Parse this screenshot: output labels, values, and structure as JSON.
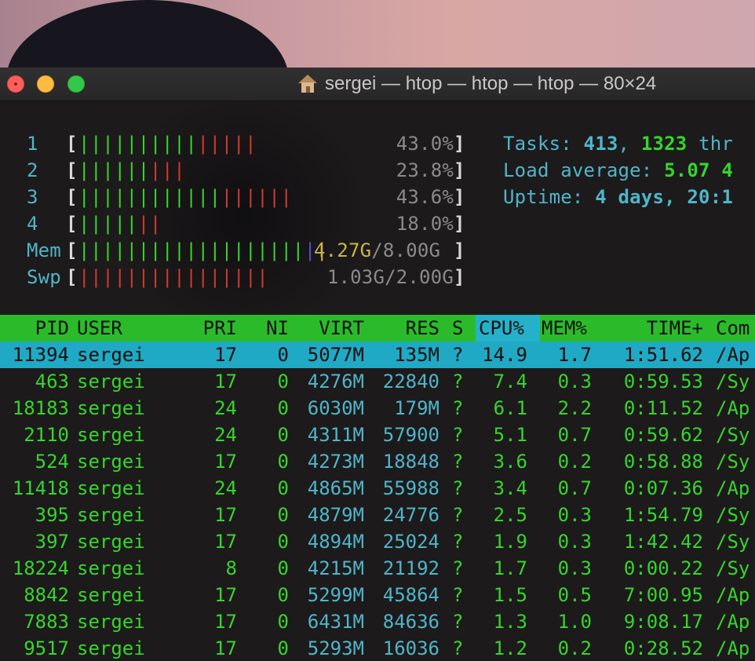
{
  "window": {
    "title": "sergei — htop — htop — htop — 80×24"
  },
  "meters": {
    "cpus": [
      {
        "label": "1",
        "green_bars": "||||||||||",
        "red_bars": "|||||",
        "value": "43.0%"
      },
      {
        "label": "2",
        "green_bars": "||||||",
        "red_bars": "|||",
        "value": "23.8%"
      },
      {
        "label": "3",
        "green_bars": "||||||||||||",
        "red_bars": "||||||",
        "value": "43.6%"
      },
      {
        "label": "4",
        "green_bars": "|||||",
        "red_bars": "||",
        "value": "18.0%"
      }
    ],
    "mem": {
      "label": "Mem",
      "green_bars": "|||||||||||||||||||",
      "blue_bars": "|",
      "yellow_bars": "|",
      "used": "4.27G",
      "total": "/8.00G"
    },
    "swp": {
      "label": "Swp",
      "red_bars": "||||||||||||||||",
      "value": "1.03G/2.00G"
    }
  },
  "summary": {
    "tasks_label": "Tasks: ",
    "tasks_value": "413",
    "tasks_sep": ", ",
    "threads_value": "1323",
    "threads_label": " thr",
    "load_label": "Load average: ",
    "load_value": "5.07 4",
    "uptime_label": "Uptime: ",
    "uptime_value": "4 days, 20:1"
  },
  "table": {
    "headers": {
      "pid": "PID",
      "user": "USER",
      "pri": "PRI",
      "ni": "NI",
      "virt": "VIRT",
      "res": "RES",
      "s": "S",
      "cpu": "CPU%",
      "mem": "MEM%",
      "time": "TIME+",
      "cmd": "Com"
    },
    "rows": [
      {
        "pid": "11394",
        "user": "sergei",
        "pri": "17",
        "ni": "0",
        "virt": "5077M",
        "res": "135M",
        "s": "?",
        "cpu": "14.9",
        "mem": "1.7",
        "time": "1:51.62",
        "cmd": "/Ap"
      },
      {
        "pid": "463",
        "user": "sergei",
        "pri": "17",
        "ni": "0",
        "virt": "4276M",
        "res": "22840",
        "s": "?",
        "cpu": "7.4",
        "mem": "0.3",
        "time": "0:59.53",
        "cmd": "/Sy"
      },
      {
        "pid": "18183",
        "user": "sergei",
        "pri": "24",
        "ni": "0",
        "virt": "6030M",
        "res": "179M",
        "s": "?",
        "cpu": "6.1",
        "mem": "2.2",
        "time": "0:11.52",
        "cmd": "/Ap"
      },
      {
        "pid": "2110",
        "user": "sergei",
        "pri": "24",
        "ni": "0",
        "virt": "4311M",
        "res": "57900",
        "s": "?",
        "cpu": "5.1",
        "mem": "0.7",
        "time": "0:59.62",
        "cmd": "/Sy"
      },
      {
        "pid": "524",
        "user": "sergei",
        "pri": "17",
        "ni": "0",
        "virt": "4273M",
        "res": "18848",
        "s": "?",
        "cpu": "3.6",
        "mem": "0.2",
        "time": "0:58.88",
        "cmd": "/Sy"
      },
      {
        "pid": "11418",
        "user": "sergei",
        "pri": "24",
        "ni": "0",
        "virt": "4865M",
        "res": "55988",
        "s": "?",
        "cpu": "3.4",
        "mem": "0.7",
        "time": "0:07.36",
        "cmd": "/Ap"
      },
      {
        "pid": "395",
        "user": "sergei",
        "pri": "17",
        "ni": "0",
        "virt": "4879M",
        "res": "24776",
        "s": "?",
        "cpu": "2.5",
        "mem": "0.3",
        "time": "1:54.79",
        "cmd": "/Sy"
      },
      {
        "pid": "397",
        "user": "sergei",
        "pri": "17",
        "ni": "0",
        "virt": "4894M",
        "res": "25024",
        "s": "?",
        "cpu": "1.9",
        "mem": "0.3",
        "time": "1:42.42",
        "cmd": "/Sy"
      },
      {
        "pid": "18224",
        "user": "sergei",
        "pri": "8",
        "ni": "0",
        "virt": "4215M",
        "res": "21192",
        "s": "?",
        "cpu": "1.7",
        "mem": "0.3",
        "time": "0:00.22",
        "cmd": "/Sy"
      },
      {
        "pid": "8842",
        "user": "sergei",
        "pri": "17",
        "ni": "0",
        "virt": "5299M",
        "res": "45864",
        "s": "?",
        "cpu": "1.5",
        "mem": "0.5",
        "time": "7:00.95",
        "cmd": "/Ap"
      },
      {
        "pid": "7883",
        "user": "sergei",
        "pri": "17",
        "ni": "0",
        "virt": "6431M",
        "res": "84636",
        "s": "?",
        "cpu": "1.3",
        "mem": "1.0",
        "time": "9:08.17",
        "cmd": "/Ap"
      },
      {
        "pid": "9517",
        "user": "sergei",
        "pri": "17",
        "ni": "0",
        "virt": "5293M",
        "res": "16036",
        "s": "?",
        "cpu": "1.2",
        "mem": "0.2",
        "time": "0:28.52",
        "cmd": "/Ap"
      }
    ]
  }
}
